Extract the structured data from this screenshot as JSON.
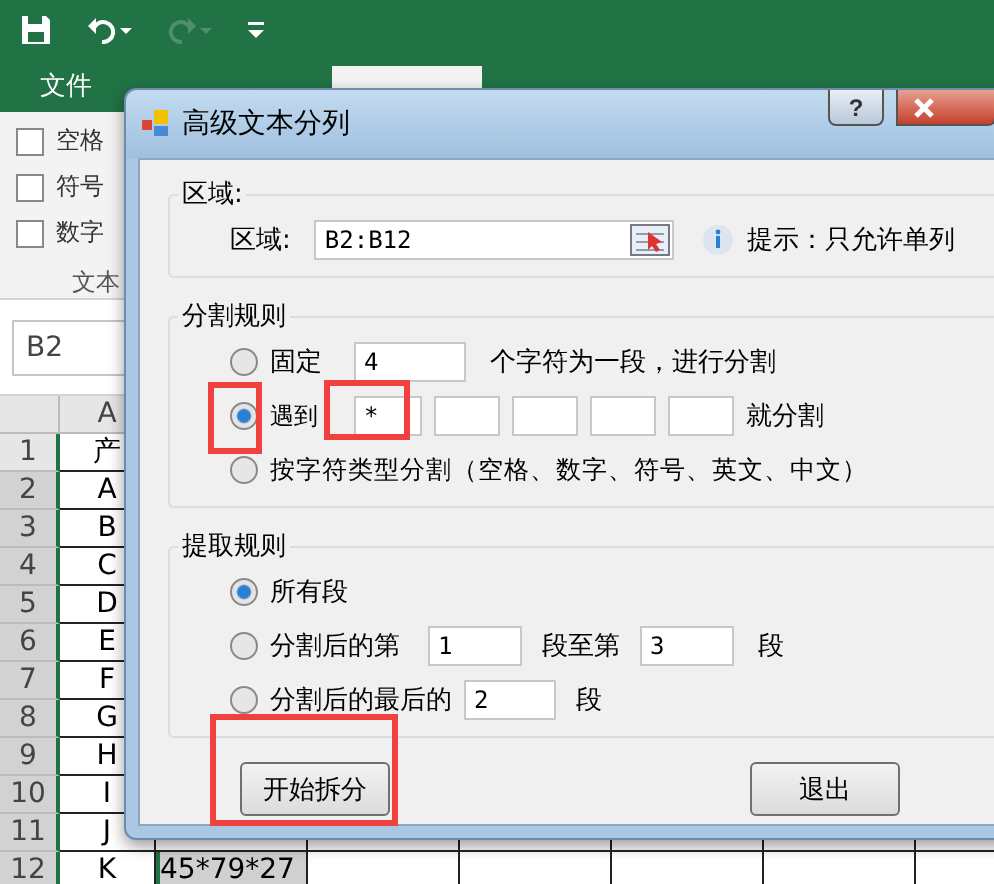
{
  "ribbon_tabs": [
    {
      "label": "文件",
      "selected": false
    }
  ],
  "ribbon_checks": [
    {
      "label": "空格",
      "checked": false
    },
    {
      "label": "符号",
      "checked": false
    },
    {
      "label": "数字",
      "checked": false
    }
  ],
  "ribbon_group_label": "文本",
  "name_box": "B2",
  "column_header": "A",
  "rows": [
    {
      "number": "1",
      "cell": "产"
    },
    {
      "number": "2",
      "cell": "A"
    },
    {
      "number": "3",
      "cell": "B"
    },
    {
      "number": "4",
      "cell": "C"
    },
    {
      "number": "5",
      "cell": "D"
    },
    {
      "number": "6",
      "cell": "E"
    },
    {
      "number": "7",
      "cell": "F"
    },
    {
      "number": "8",
      "cell": "G"
    },
    {
      "number": "9",
      "cell": "H"
    },
    {
      "number": "10",
      "cell": "I"
    },
    {
      "number": "11",
      "cell": "J"
    },
    {
      "number": "12",
      "cell": "K"
    }
  ],
  "row12_b": "45*79*27",
  "dialog": {
    "title": "高级文本分列",
    "help": "?",
    "region": {
      "legend": "区域:",
      "label": "区域:",
      "value": "B2:B12",
      "hint": "提示：只允许单列"
    },
    "split": {
      "legend": "分割规则",
      "fixed": {
        "label": "固定",
        "value": "4",
        "suffix": "个字符为一段，进行分割",
        "selected": false
      },
      "delimiter": {
        "label": "遇到",
        "fields": [
          {
            "kind": "text",
            "value": "*"
          },
          {
            "kind": "empty"
          },
          {
            "kind": "empty"
          },
          {
            "kind": "empty"
          },
          {
            "kind": "empty"
          }
        ],
        "suffix": "就分割",
        "selected": true
      },
      "by_type": {
        "label": "按字符类型分割（空格、数字、符号、英文、中文）",
        "selected": false
      }
    },
    "extract": {
      "legend": "提取规则",
      "all": {
        "label": "所有段",
        "selected": true
      },
      "range": {
        "label": "分割后的第",
        "from": "1",
        "middle": "段至第",
        "to": "3",
        "suffix": "段",
        "selected": false
      },
      "last": {
        "label": "分割后的最后的",
        "value": "2",
        "suffix": "段",
        "selected": false
      }
    },
    "buttons": [
      "开始拆分",
      "退出"
    ]
  }
}
